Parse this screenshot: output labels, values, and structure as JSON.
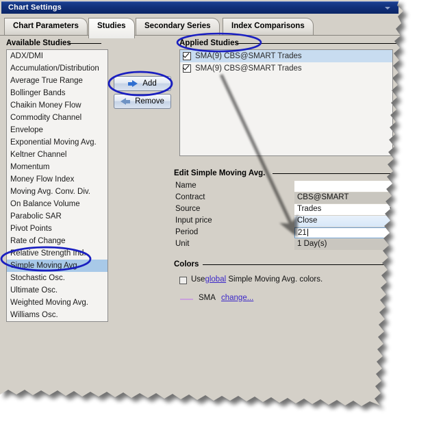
{
  "window": {
    "title": "Chart Settings",
    "menu_caret_icon": "chevron-down-icon"
  },
  "tabs": [
    {
      "label": "Chart Parameters",
      "active": false
    },
    {
      "label": "Studies",
      "active": true
    },
    {
      "label": "Secondary Series",
      "active": false
    },
    {
      "label": "Index Comparisons",
      "active": false
    }
  ],
  "available_studies": {
    "label": "Available Studies",
    "items": [
      "ADX/DMI",
      "Accumulation/Distribution",
      "Average True Range",
      "Bollinger Bands",
      "Chaikin Money Flow",
      "Commodity Channel",
      "Envelope",
      "Exponential Moving Avg.",
      "Keltner Channel",
      "Momentum",
      "Money Flow Index",
      "Moving Avg. Conv. Div.",
      "On Balance Volume",
      "Parabolic SAR",
      "Pivot Points",
      "Rate of Change",
      "Relative Strength Ind.",
      "Simple Moving Avg.",
      "Stochastic Osc.",
      "Ultimate Osc.",
      "Weighted Moving Avg.",
      "Williams Osc."
    ],
    "selected": "Simple Moving Avg."
  },
  "transfer_buttons": {
    "add_label": "Add",
    "remove_label": "Remove",
    "add_icon": "arrow-right-icon",
    "remove_icon": "arrow-left-icon"
  },
  "applied_studies": {
    "label": "Applied Studies",
    "items": [
      {
        "label": "SMA(9) CBS@SMART Trades",
        "checked": true,
        "selected": true
      },
      {
        "label": "SMA(9) CBS@SMART Trades",
        "checked": true,
        "selected": false
      }
    ]
  },
  "edit_panel": {
    "label": "Edit Simple Moving Avg.",
    "fields": [
      {
        "label": "Name",
        "value": "",
        "type": "text"
      },
      {
        "label": "Contract",
        "value": "CBS@SMART",
        "type": "readonly"
      },
      {
        "label": "Source",
        "value": "Trades",
        "type": "combo"
      },
      {
        "label": "Input price",
        "value": "Close",
        "type": "combo"
      },
      {
        "label": "Period",
        "value": "21",
        "type": "editing"
      },
      {
        "label": "Unit",
        "value": "1 Day(s)",
        "type": "readonly"
      }
    ]
  },
  "colors": {
    "label": "Colors",
    "use_global_prefix": "Use",
    "use_global_link": "global",
    "use_global_suffix": " Simple Moving Avg. colors.",
    "use_global_checked": false,
    "series_name": "SMA",
    "change_link": "change...",
    "series_color": "#c9a0dc"
  },
  "annotations": {
    "highlight_color": "#1a1fc0",
    "arrow_color": "#cc1111",
    "ellipses": [
      "applied-studies-label",
      "add-button",
      "simple-moving-avg-list-item"
    ],
    "arrow": "from-applied-study-to-period-field"
  }
}
